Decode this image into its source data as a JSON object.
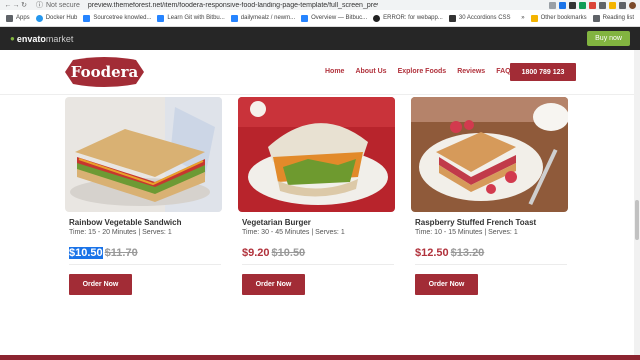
{
  "browser": {
    "security": "Not secure",
    "url": "preview.themeforest.net/item/foodera-responsive-food-landing-page-template/full_screen_preview/24..."
  },
  "bookmarks": {
    "items": [
      "Apps",
      "Docker Hub",
      "Sourcetree knowled...",
      "Learn Git with Bitbu...",
      "dailymealz / newm...",
      "Overview — Bitbuc...",
      "ERROR: for webapp...",
      "30 Accordions CSS"
    ],
    "more": "»",
    "other": "Other bookmarks",
    "reading": "Reading list"
  },
  "envato": {
    "brand": "envato",
    "brand_suffix": "market",
    "buy_label": "Buy now",
    "accent": "#82b440"
  },
  "site": {
    "logo": "Foodera",
    "menu": [
      "Home",
      "About Us",
      "Explore Foods",
      "Reviews",
      "FAQ"
    ],
    "phone": "1800 789 123",
    "brand_color": "#a22c36"
  },
  "products": [
    {
      "name": "Rainbow Vegetable Sandwich",
      "meta": "Time: 15 - 20 Minutes | Serves: 1",
      "price": "$10.50",
      "old_price": "$11.70",
      "cta": "Order Now"
    },
    {
      "name": "Vegetarian Burger",
      "meta": "Time: 30 - 45 Minutes | Serves: 1",
      "price": "$9.20",
      "old_price": "$10.50",
      "cta": "Order Now"
    },
    {
      "name": "Raspberry Stuffed French Toast",
      "meta": "Time: 10 - 15 Minutes | Serves: 1",
      "price": "$12.50",
      "old_price": "$13.20",
      "cta": "Order Now"
    }
  ]
}
